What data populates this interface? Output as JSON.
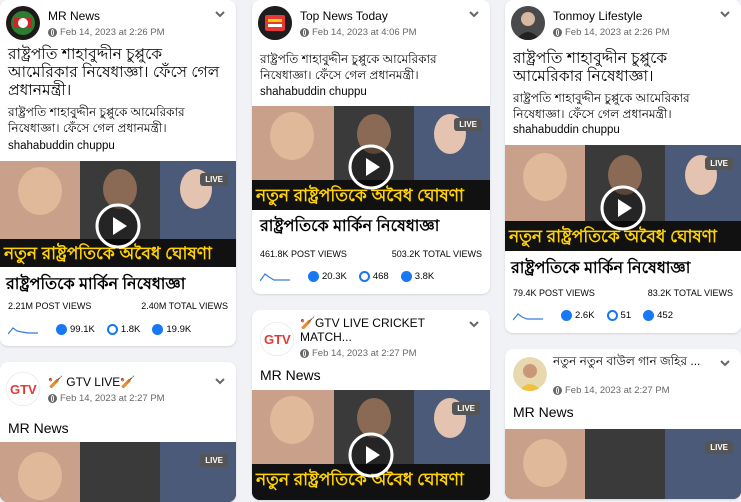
{
  "cards": [
    {
      "page_name": "MR News",
      "timestamp": "Feb 14, 2023 at 2:26 PM",
      "title": "রাষ্ট্রপতি শাহাবুদ্দীন চুপ্পুকে আমেরিকার নিষেধাজ্ঞা। ফেঁসে গেল প্রধানমন্ত্রী।",
      "body": "রাষ্ট্রপতি শাহাবুদ্দীন চুপ্পুকে আমেরিকার নিষেধাজ্ঞা। ফেঁসে গেল প্রধানমন্ত্রী।",
      "tag": "shahabuddin chuppu",
      "post_views": "2.21M POST VIEWS",
      "total_views": "2.40M TOTAL VIEWS",
      "reactions": "99.1K",
      "comments": "1.8K",
      "shares": "19.9K"
    },
    {
      "page_name": "Top News Today",
      "timestamp": "Feb 14, 2023 at 4:06 PM",
      "body": "রাষ্ট্রপতি শাহাবুদ্দীন চুপ্পুকে আমেরিকার নিষেধাজ্ঞা। ফেঁসে গেল প্রধানমন্ত্রী।",
      "tag": "shahabuddin chuppu",
      "post_views": "461.8K POST VIEWS",
      "total_views": "503.2K TOTAL VIEWS",
      "reactions": "20.3K",
      "comments": "468",
      "shares": "3.8K"
    },
    {
      "page_name": "Tonmoy Lifestyle",
      "timestamp": "Feb 14, 2023 at 2:26 PM",
      "title": "রাষ্ট্রপতি শাহাবুদ্দীন চুপ্পুকে আমেরিকার নিষেধাজ্ঞা।",
      "body": "রাষ্ট্রপতি শাহাবুদ্দীন চুপ্পুকে আমেরিকার নিষেধাজ্ঞা। ফেঁসে গেল প্রধানমন্ত্রী।",
      "tag": "shahabuddin chuppu",
      "post_views": "79.4K POST VIEWS",
      "total_views": "83.2K TOTAL VIEWS",
      "reactions": "2.6K",
      "comments": "51",
      "shares": "452"
    },
    {
      "page_name": "🏏 GTV LIVE🏏",
      "timestamp": "Feb 14, 2023 at 2:27 PM",
      "body": "MR News"
    },
    {
      "page_name": "🏏GTV LIVE CRICKET MATCH...",
      "timestamp": "Feb 14, 2023 at 2:27 PM",
      "body": "MR News"
    },
    {
      "page_name": "নতুন নতুন বাউল গান জহির ...",
      "timestamp": "Feb 14, 2023 at 2:27 PM",
      "body": "MR News"
    }
  ],
  "thumbnail": {
    "banner_text": "নতুন রাষ্ট্রপতিকে অবৈধ ঘোষণা",
    "sub_text": "রাষ্ট্রপতিকে মার্কিন নিষেধাজ্ঞা",
    "live_label": "LIVE"
  },
  "colors": {
    "page_bg": "#f0f2f5",
    "banner_yellow": "#ffd200",
    "live_badge": "#555555",
    "like_blue": "#1877f2",
    "love_red": "#f33e58"
  },
  "icons": [
    "globe-icon",
    "chevron-down-icon",
    "play-icon",
    "reaction-icon",
    "comment-icon",
    "share-icon"
  ]
}
